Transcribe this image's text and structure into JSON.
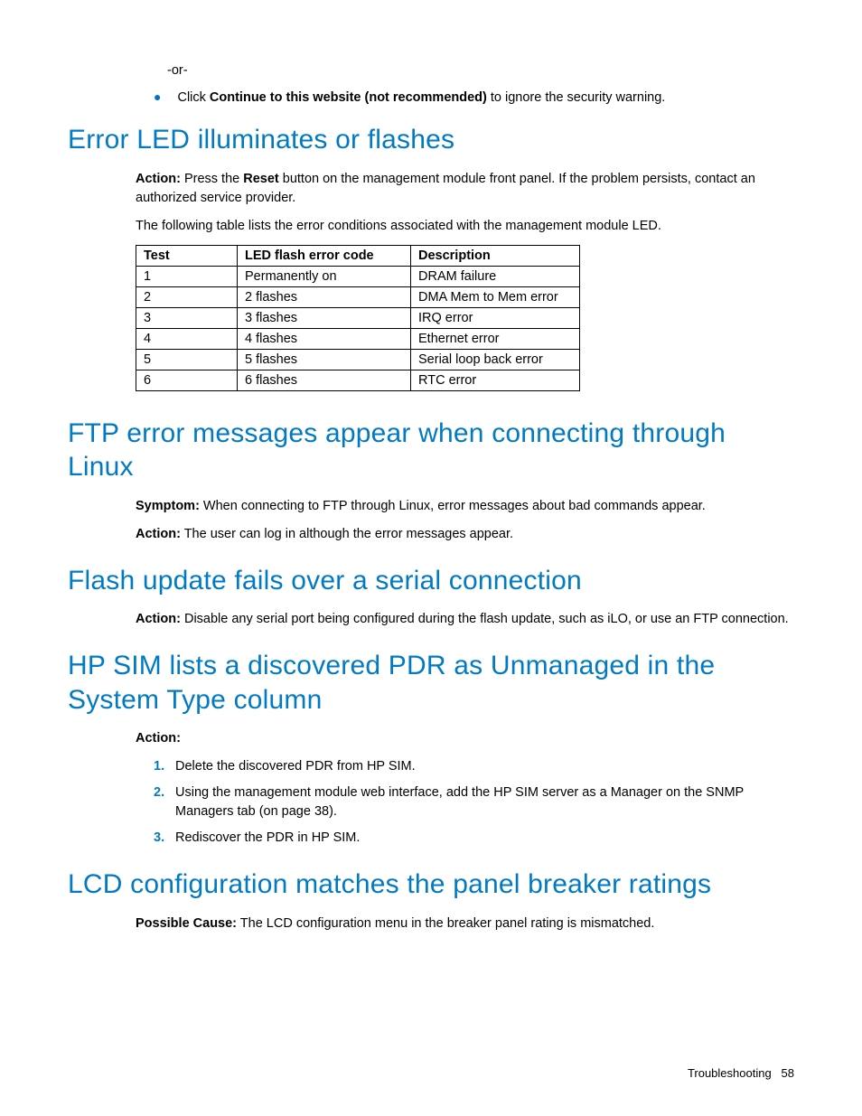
{
  "top": {
    "or_text": "-or-",
    "bullet_prefix": "Click ",
    "bullet_bold": "Continue to this website (not recommended)",
    "bullet_suffix": " to ignore the security warning."
  },
  "section1": {
    "heading": "Error LED illuminates or flashes",
    "action_label": "Action:",
    "action_pre": " Press the ",
    "action_bold": "Reset",
    "action_post": " button on the management module front panel. If the problem persists, contact an authorized service provider.",
    "table_intro": "The following table lists the error conditions associated with the management module LED.",
    "table": {
      "headers": [
        "Test",
        "LED flash error code",
        "Description"
      ],
      "colwidths": [
        "95px",
        "175px",
        "170px"
      ],
      "rows": [
        [
          "1",
          "Permanently on",
          "DRAM failure"
        ],
        [
          "2",
          "2 flashes",
          "DMA Mem to Mem error"
        ],
        [
          "3",
          "3 flashes",
          "IRQ error"
        ],
        [
          "4",
          "4 flashes",
          "Ethernet error"
        ],
        [
          "5",
          "5 flashes",
          "Serial loop back error"
        ],
        [
          "6",
          "6 flashes",
          "RTC error"
        ]
      ]
    }
  },
  "section2": {
    "heading": "FTP error messages appear when connecting through Linux",
    "symptom_label": "Symptom:",
    "symptom_text": " When connecting to FTP through Linux, error messages about bad commands appear.",
    "action_label": "Action:",
    "action_text": " The user can log in although the error messages appear."
  },
  "section3": {
    "heading": "Flash update fails over a serial connection",
    "action_label": "Action:",
    "action_text": " Disable any serial port being configured during the flash update, such as iLO, or use an FTP connection."
  },
  "section4": {
    "heading": "HP SIM lists a discovered PDR as Unmanaged in the System Type column",
    "action_label": "Action:",
    "steps": [
      "Delete the discovered PDR from HP SIM.",
      "Using the management module web interface, add the HP SIM server as a Manager on the SNMP Managers tab (on page 38).",
      "Rediscover the PDR in HP SIM."
    ]
  },
  "section5": {
    "heading": "LCD configuration matches the panel breaker ratings",
    "cause_label": "Possible Cause:",
    "cause_text": " The LCD configuration menu in the breaker panel rating is mismatched."
  },
  "footer": {
    "section": "Troubleshooting",
    "page": "58"
  }
}
